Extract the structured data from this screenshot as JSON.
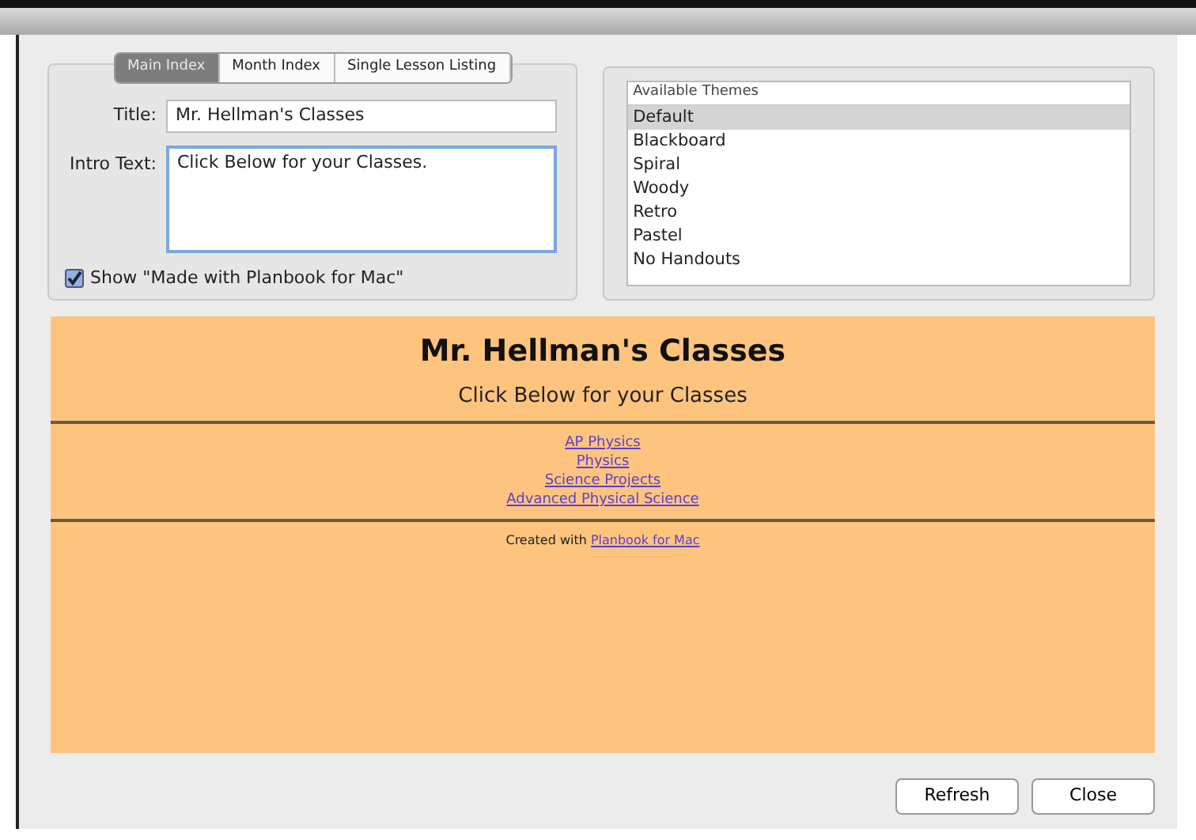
{
  "tabs": [
    {
      "label": "Main Index",
      "selected": true
    },
    {
      "label": "Month Index",
      "selected": false
    },
    {
      "label": "Single Lesson Listing",
      "selected": false
    }
  ],
  "title_field": {
    "label": "Title:",
    "value": "Mr. Hellman's Classes"
  },
  "intro_field": {
    "label": "Intro Text:",
    "value": "Click Below for your Classes."
  },
  "show_credit": {
    "label": "Show \"Made with Planbook for Mac\"",
    "checked": true
  },
  "themes": {
    "header": "Available Themes",
    "items": [
      {
        "label": "Default",
        "selected": true
      },
      {
        "label": "Blackboard",
        "selected": false
      },
      {
        "label": "Spiral",
        "selected": false
      },
      {
        "label": "Woody",
        "selected": false
      },
      {
        "label": "Retro",
        "selected": false
      },
      {
        "label": "Pastel",
        "selected": false
      },
      {
        "label": "No Handouts",
        "selected": false
      }
    ]
  },
  "preview": {
    "heading": "Mr. Hellman's Classes",
    "subheading": "Click Below for your Classes",
    "links": [
      "AP Physics",
      "Physics",
      "Science Projects",
      "Advanced Physical Science"
    ],
    "footer": {
      "text": "Created with",
      "link": "Planbook for Mac"
    }
  },
  "buttons": [
    "Refresh",
    "Close"
  ]
}
